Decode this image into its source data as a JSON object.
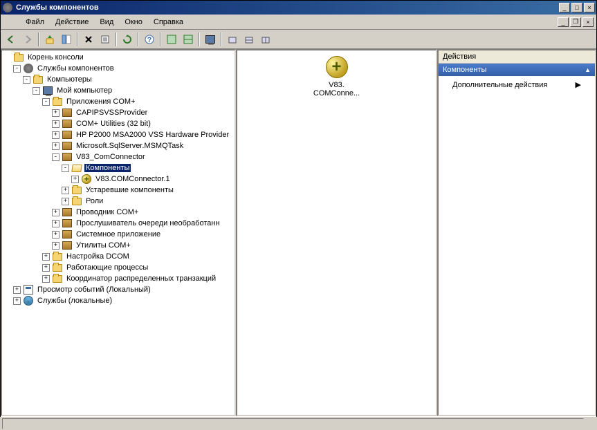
{
  "title": "Службы компонентов",
  "menu": {
    "file": "Файл",
    "action": "Действие",
    "view": "Вид",
    "window": "Окно",
    "help": "Справка"
  },
  "tree": {
    "root": "Корень консоли",
    "components_services": "Службы компонентов",
    "computers": "Компьютеры",
    "my_computer": "Мой компьютер",
    "com_apps": "Приложения COM+",
    "capipsvss": "CAPIPSVSSProvider",
    "com_utilities": "COM+ Utilities (32 bit)",
    "hp_provider": "HP P2000 MSA2000 VSS Hardware Provider",
    "sqlserver_msmq": "Microsoft.SqlServer.MSMQTask",
    "v83_connector": "V83_ComConnector",
    "components": "Компоненты",
    "v83_comconnector_1": "V83.COMConnector.1",
    "legacy_components": "Устаревшие компоненты",
    "roles": "Роли",
    "com_explorer": "Проводник COM+",
    "queue_listener": "Прослушиватель очереди необработанн",
    "system_app": "Системное приложение",
    "com_utilities2": "Утилиты COM+",
    "dcom_config": "Настройка DCOM",
    "running_processes": "Работающие процессы",
    "dtc": "Координатор распределенных транзакций",
    "event_viewer": "Просмотр событий (Локальный)",
    "services_local": "Службы (локальные)"
  },
  "mid": {
    "item1": {
      "label_line1": "V83.",
      "label_line2": "COMConne..."
    }
  },
  "actions": {
    "header": "Действия",
    "title": "Компоненты",
    "additional": "Дополнительные действия"
  }
}
